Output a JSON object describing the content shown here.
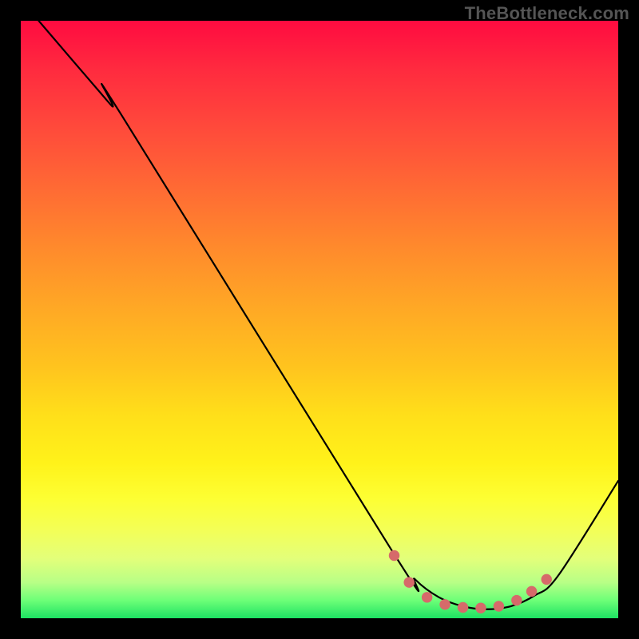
{
  "watermark": "TheBottleneck.com",
  "chart_data": {
    "type": "line",
    "title": "",
    "xlabel": "",
    "ylabel": "",
    "xlim": [
      0,
      100
    ],
    "ylim": [
      0,
      100
    ],
    "grid": false,
    "series": [
      {
        "name": "curve",
        "x": [
          3,
          15,
          17,
          62,
          66,
          70,
          74,
          78,
          82,
          86,
          90,
          100
        ],
        "y": [
          100,
          86,
          84,
          11.5,
          6.5,
          3.5,
          2.0,
          1.5,
          2.0,
          3.8,
          7.2,
          23
        ]
      }
    ],
    "markers": {
      "name": "bottleneck-range",
      "x": [
        62.5,
        65,
        68,
        71,
        74,
        77,
        80,
        83,
        85.5,
        88
      ],
      "y": [
        10.5,
        6.0,
        3.5,
        2.3,
        1.8,
        1.7,
        2.0,
        3.0,
        4.5,
        6.5
      ]
    },
    "colors": {
      "curve": "#000000",
      "markers": "#d66a6a",
      "gradient_top": "#ff0b40",
      "gradient_bottom": "#1de263"
    }
  }
}
